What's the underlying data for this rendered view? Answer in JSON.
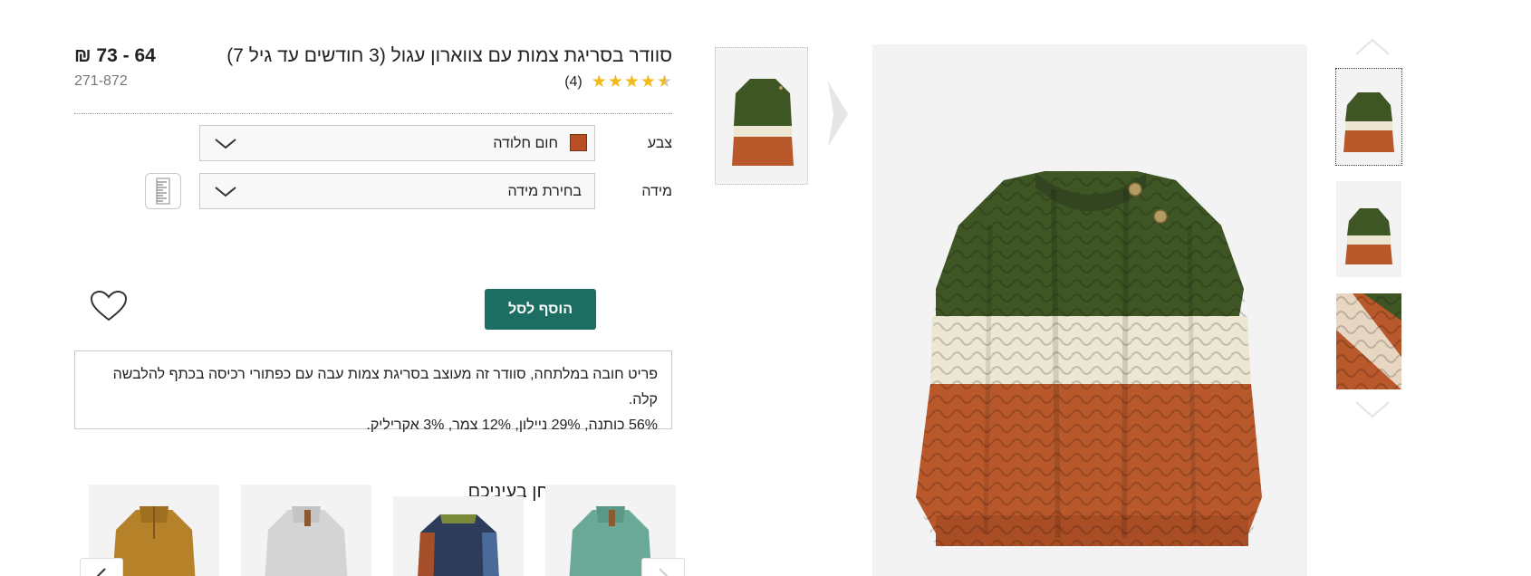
{
  "product": {
    "title": "סוודר בסריגת צמות עם צווארון עגול (3 חודשים עד גיל 7)",
    "price": "64 - 73 ₪",
    "sku": "271-872",
    "rating_count": "(4)",
    "rating": 4.5,
    "rating_max": 5
  },
  "options": {
    "color_label": "צבע",
    "color_value": "חום חלודה",
    "color_swatch": "#b84f24",
    "size_label": "מידה",
    "size_value": "בחירת מידה"
  },
  "actions": {
    "add_to_bag": "הוסף לסל"
  },
  "description": {
    "line1": "פריט חובה במלתחה, סוודר זה מעוצב בסריגת צמות עבה עם כפתורי רכיסה בכתף להלבשה קלה.",
    "line2": "56% כותנה, 29% ניילון, 12% צמר, 3% אקריליק."
  },
  "recommendations": {
    "title": "ייתכן שגם ימצא חן בעיניכם",
    "items": [
      {
        "color": "#6aa898"
      },
      {
        "color": "#2c3c5a"
      },
      {
        "color": "#d4d4d4"
      },
      {
        "color": "#b5822a"
      }
    ]
  },
  "colors": {
    "accent": "#1c6e63",
    "sweater_green": "#3e5524",
    "sweater_cream": "#ece6d3",
    "sweater_rust": "#b8582b"
  }
}
